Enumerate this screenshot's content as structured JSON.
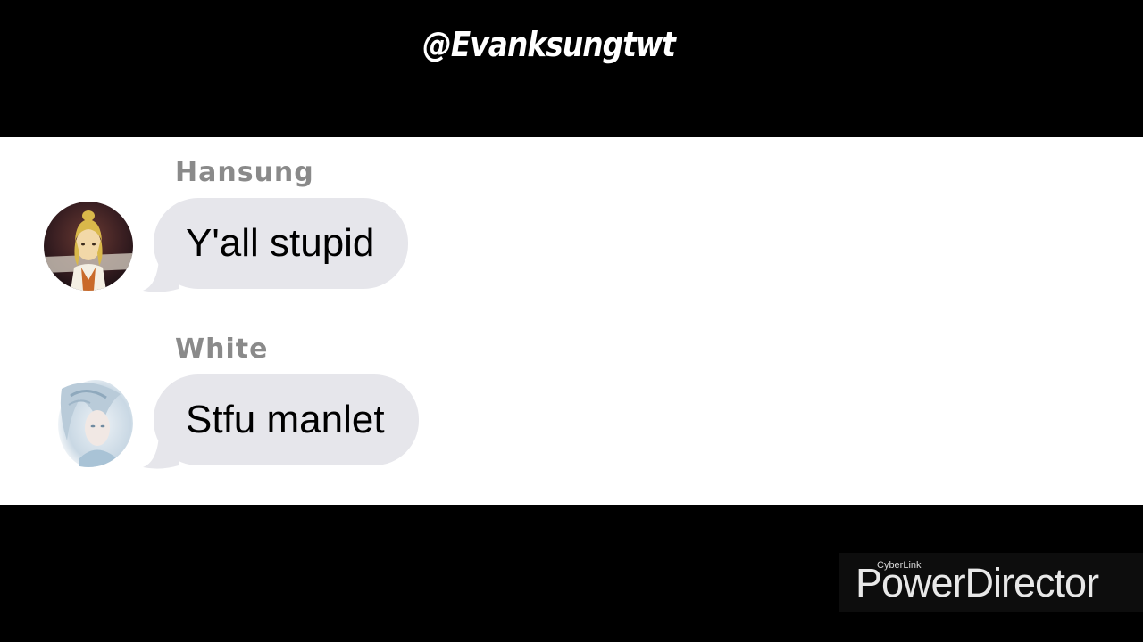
{
  "header": {
    "handle": "@Evanksungtwt"
  },
  "chat": {
    "messages": [
      {
        "sender": "Hansung",
        "text": "Y'all stupid",
        "avatar_icon": "avatar-hansung-icon"
      },
      {
        "sender": "White",
        "text": "Stfu manlet",
        "avatar_icon": "avatar-white-icon"
      }
    ]
  },
  "watermark": {
    "brand": "CyberLink",
    "product": "PowerDirector"
  },
  "colors": {
    "background": "#000000",
    "panel": "#ffffff",
    "bubble": "#e6e6eb",
    "sender_name": "#8a8a8a",
    "message_text": "#000000"
  }
}
